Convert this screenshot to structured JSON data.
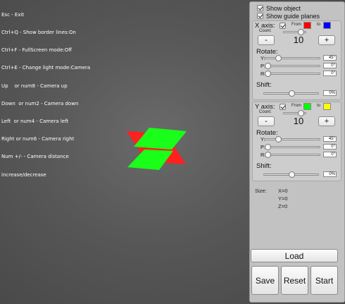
{
  "help_lines": [
    "Esc - Exit",
    "Ctrl+Q - Show border lines:On",
    "Ctrl+F - FullScreen mode:Off",
    "Ctrl+E - Change light mode:Camera",
    "Up    or num8 - Camera up",
    "Down  or num2 - Camera down",
    "Left  or num4 - Camera left",
    "Right or num6 - Camera right",
    "Num +/- - Camera distance",
    "increase/decrease"
  ],
  "panel": {
    "show_object": "Show object",
    "show_guide_planes": "Show guide planes",
    "x_axis": {
      "title": "X axis:",
      "from_label": "From",
      "to_label": "to",
      "from_color": "#ff0000",
      "to_color": "#0000ff",
      "count_label": "Count:",
      "count": "10",
      "minus": "-",
      "plus": "+",
      "rotate_label": "Rotate:",
      "y_label": "Y:",
      "p_label": "P:",
      "r_label": "R:",
      "y_value": "45°",
      "p_value": "0°",
      "r_value": "0°",
      "shift_label": "Shift:",
      "shift_value": "0%"
    },
    "y_axis": {
      "title": "Y axis:",
      "from_label": "From",
      "to_label": "to",
      "from_color": "#00ff00",
      "to_color": "#ffff00",
      "count_label": "Count:",
      "count": "10",
      "minus": "-",
      "plus": "+",
      "rotate_label": "Rotate:",
      "y_label": "Y:",
      "p_label": "P:",
      "r_label": "R:",
      "y_value": "45°",
      "p_value": "0°",
      "r_value": "0°",
      "shift_label": "Shift:",
      "shift_value": "0%"
    },
    "size": {
      "label": "Size:",
      "x": "X=0",
      "y": "Y=0",
      "z": "Z=0"
    },
    "load": "Load",
    "save": "Save",
    "reset": "Reset",
    "start": "Start"
  },
  "scene": {
    "plane_colors": [
      "#ff2020",
      "#19ff19"
    ]
  }
}
